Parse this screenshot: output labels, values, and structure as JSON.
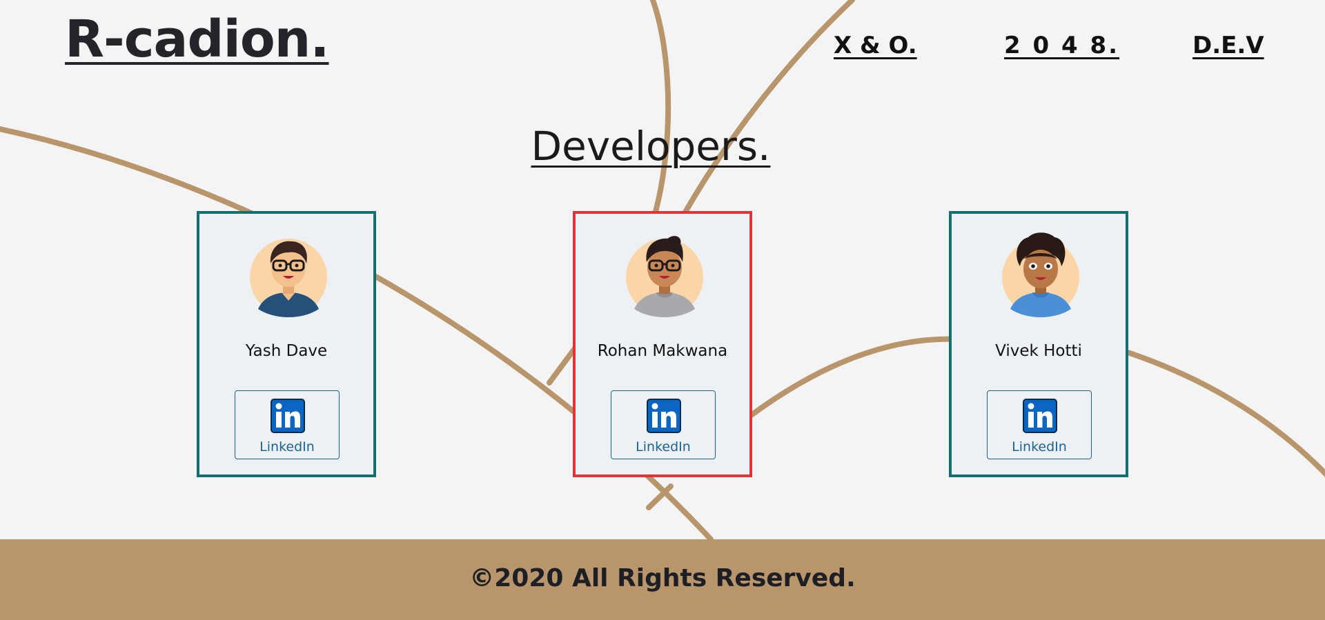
{
  "header": {
    "brand": "R-cadion.",
    "nav": [
      "X & O.",
      "2 0 4 8.",
      "D.E.V"
    ]
  },
  "main": {
    "title": "Developers.",
    "developers": [
      {
        "name": "Yash Dave",
        "button_label": "LinkedIn",
        "icon": "linkedin-icon",
        "hoodie_color": "#24507a",
        "skin": "#f4c08e",
        "hair": "#3a2420",
        "selected": false
      },
      {
        "name": "Rohan Makwana",
        "button_label": "LinkedIn",
        "icon": "linkedin-icon",
        "hoodie_color": "#a7a9ac",
        "skin": "#c98656",
        "hair": "#2a1c1a",
        "selected": true
      },
      {
        "name": "Vivek Hotti",
        "button_label": "LinkedIn",
        "icon": "linkedin-icon",
        "hoodie_color": "#4a8fd8",
        "skin": "#b87847",
        "hair": "#2a1a16",
        "selected": false
      }
    ]
  },
  "footer": {
    "text": "©2020 All Rights Reserved."
  },
  "colors": {
    "background": "#f4f4f4",
    "curve": "#b8956b",
    "card_border": "#127070",
    "card_border_selected": "#e0343a",
    "footer_bg": "#b8956b",
    "linkedin_blue": "#1c6394"
  }
}
